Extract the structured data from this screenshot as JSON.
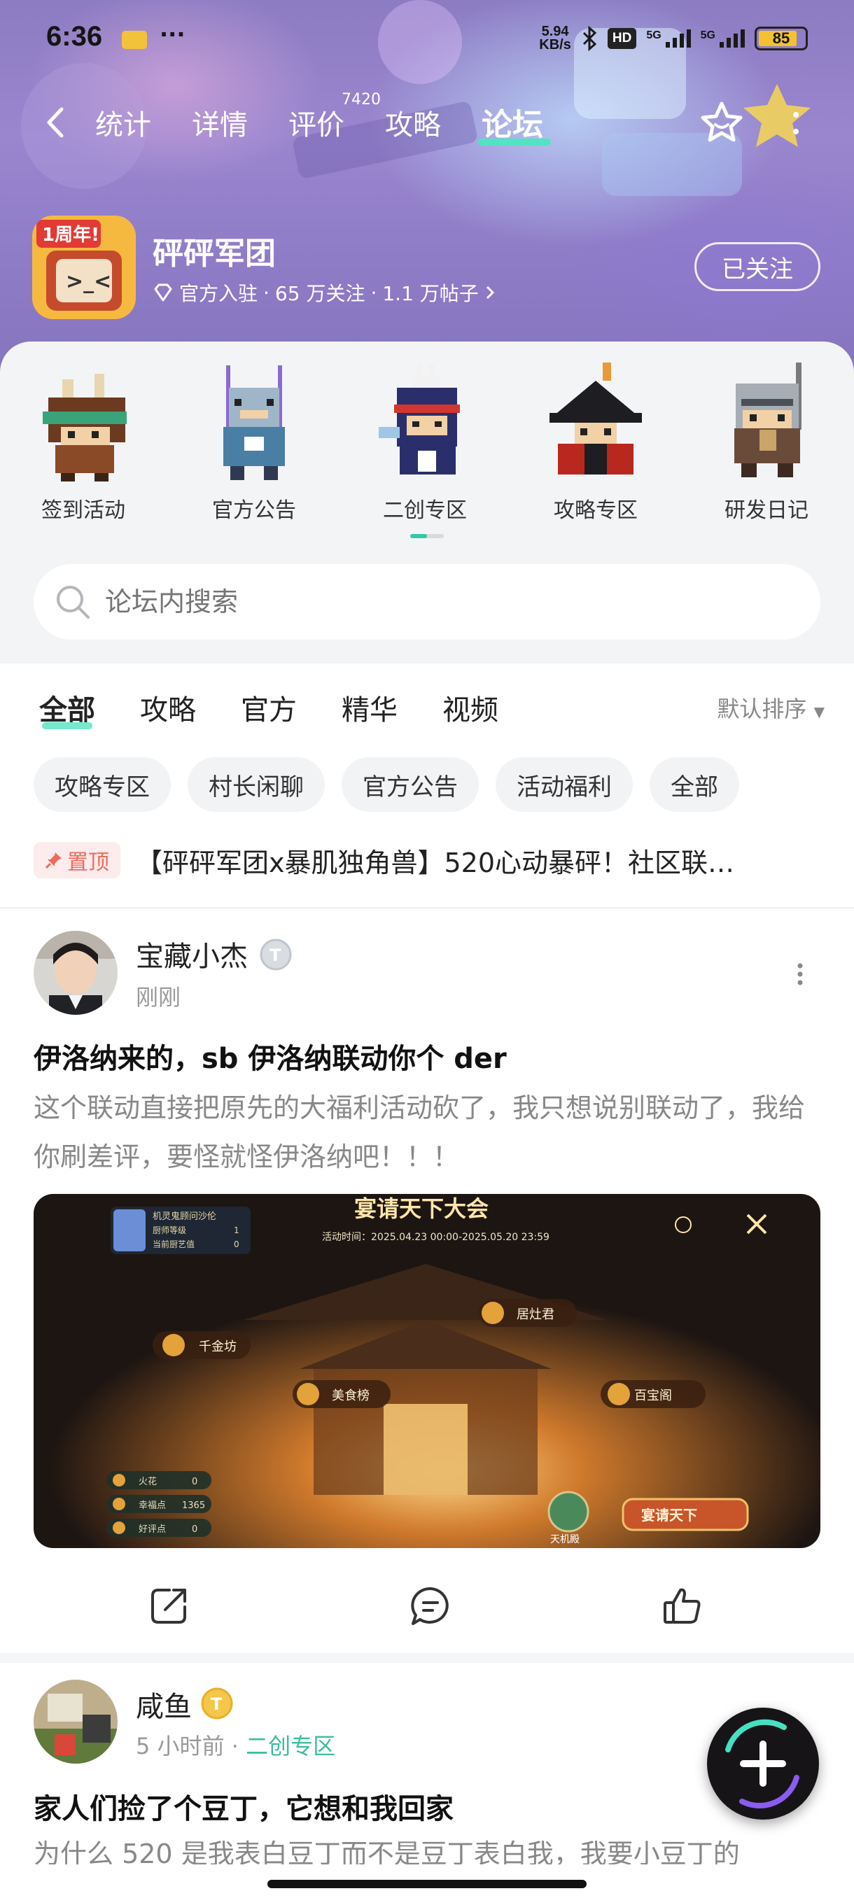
{
  "status_bar": {
    "time": "6:36",
    "dots": "···",
    "speed_top": "5.94",
    "speed_bottom": "KB/s",
    "hd": "HD",
    "net1": "5G",
    "net2": "5G",
    "battery": "85",
    "battery_level": 0.85
  },
  "nav": {
    "tabs": [
      "统计",
      "详情",
      "评价",
      "攻略",
      "论坛"
    ],
    "active_tab": "论坛",
    "review_count": "7420"
  },
  "game": {
    "name": "砰砰军团",
    "icon_badge": "1周年!",
    "official": "官方入驻",
    "followers": "65 万关注",
    "posts": "1.1 万帖子",
    "sep": "·",
    "follow_label": "已关注"
  },
  "categories": [
    "签到活动",
    "官方公告",
    "二创专区",
    "攻略专区",
    "研发日记"
  ],
  "search": {
    "placeholder": "论坛内搜索"
  },
  "feed_tabs": [
    "全部",
    "攻略",
    "官方",
    "精华",
    "视频"
  ],
  "sort_label": "默认排序",
  "chips": [
    "攻略专区",
    "村长闲聊",
    "官方公告",
    "活动福利",
    "全部"
  ],
  "pinned": {
    "badge": "置顶",
    "text": "【砰砰军团x暴肌独角兽】520心动暴砰！社区联…"
  },
  "posts": [
    {
      "author": "宝藏小杰",
      "time": "刚刚",
      "title": "伊洛纳来的，sb 伊洛纳联动你个 der",
      "body": "这个联动直接把原先的大福利活动砍了，我只想说别联动了，我给你刷差评，要怪就怪伊洛纳吧！！！",
      "image": {
        "title": "宴请天下大会",
        "period": "活动时间：2025.04.23 00:00-2025.05.20 23:59",
        "stats_title": "机灵鬼顾问沙伦",
        "stats_rows": [
          [
            "厨师等级",
            "1"
          ],
          [
            "当前厨艺值",
            "0"
          ]
        ],
        "spots": [
          "居灶君",
          "千金坊",
          "美食榜",
          "百宝阁"
        ],
        "resources": [
          [
            "火花",
            "0"
          ],
          [
            "幸福点",
            "1365"
          ],
          [
            "好评点",
            "0"
          ]
        ],
        "hall": "天机殿",
        "cta": "宴请天下"
      }
    },
    {
      "author": "咸鱼",
      "time": "5 小时前",
      "dot": "·",
      "tag": "二创专区",
      "title": "家人们捡了个豆丁，它想和我回家",
      "body": "为什么 520 是我表白豆丁而不是豆丁表白我，我要小豆丁的"
    }
  ],
  "colors": {
    "accent": "#52e3c2",
    "hero_bg": "#8c7cc2",
    "pin_red": "#f06a5a",
    "tag_green": "#3bbd9f"
  }
}
